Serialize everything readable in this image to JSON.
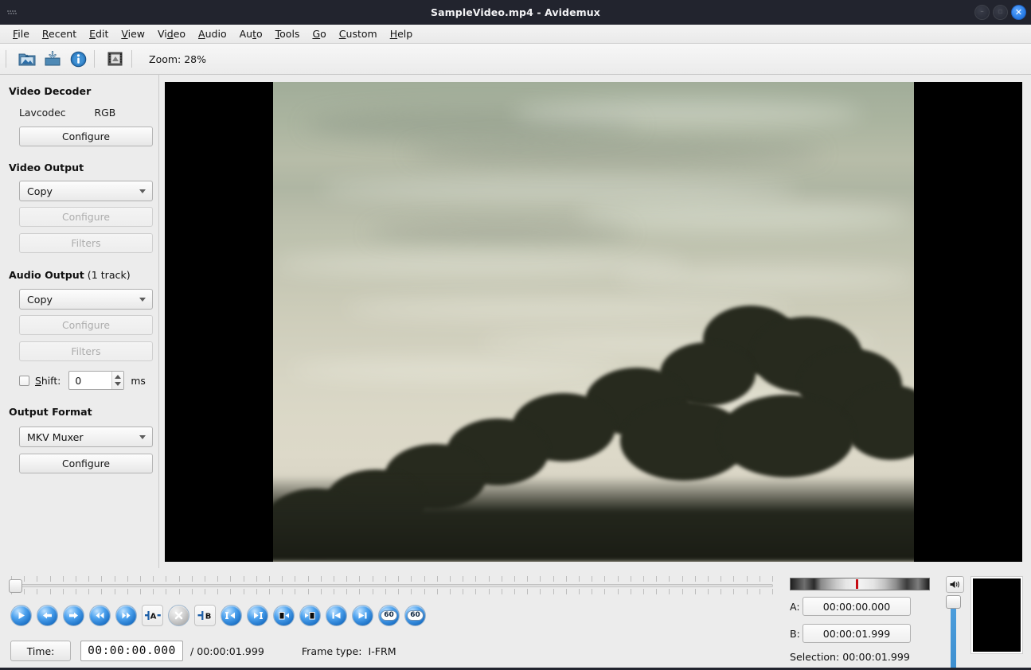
{
  "window": {
    "title": "SampleVideo.mp4 - Avidemux",
    "app_icon": "app-dots-icon",
    "controls": [
      {
        "name": "minimize-button",
        "glyph": "–"
      },
      {
        "name": "maximize-button",
        "glyph": "▫"
      },
      {
        "name": "close-button",
        "glyph": "✕"
      }
    ]
  },
  "menubar": {
    "items": [
      {
        "label": "File",
        "mnemonic": "F"
      },
      {
        "label": "Recent",
        "mnemonic": "R"
      },
      {
        "label": "Edit",
        "mnemonic": "E"
      },
      {
        "label": "View",
        "mnemonic": "V"
      },
      {
        "label": "Video",
        "mnemonic": "d"
      },
      {
        "label": "Audio",
        "mnemonic": "A"
      },
      {
        "label": "Auto",
        "mnemonic": "t"
      },
      {
        "label": "Tools",
        "mnemonic": "T"
      },
      {
        "label": "Go",
        "mnemonic": "G"
      },
      {
        "label": "Custom",
        "mnemonic": "C"
      },
      {
        "label": "Help",
        "mnemonic": "H"
      }
    ]
  },
  "toolbar": {
    "icons": [
      {
        "name": "open-file-icon",
        "title": "Open"
      },
      {
        "name": "save-file-icon",
        "title": "Save"
      },
      {
        "name": "file-info-icon",
        "title": "Properties"
      },
      {
        "name": "filmstrip-icon",
        "title": "Calculator"
      }
    ],
    "zoom_label": "Zoom: 28%"
  },
  "sidebar": {
    "video_decoder": {
      "title": "Video Decoder",
      "codec": "Lavcodec",
      "colorspace": "RGB",
      "configure_label": "Configure"
    },
    "video_output": {
      "title": "Video Output",
      "codec": "Copy",
      "configure_label": "Configure",
      "filters_label": "Filters"
    },
    "audio_output": {
      "title": "Audio Output",
      "title_suffix": " (1 track)",
      "codec": "Copy",
      "configure_label": "Configure",
      "filters_label": "Filters",
      "shift_label": "Shift:",
      "shift_value": "0",
      "shift_unit": "ms",
      "shift_checked": false
    },
    "output_format": {
      "title": "Output Format",
      "muxer": "MKV Muxer",
      "configure_label": "Configure"
    }
  },
  "transport": {
    "buttons": [
      {
        "name": "play-button",
        "icon": "play"
      },
      {
        "name": "previous-frame-button",
        "icon": "arrow-left"
      },
      {
        "name": "next-frame-button",
        "icon": "arrow-right"
      },
      {
        "name": "rewind-button",
        "icon": "double-left"
      },
      {
        "name": "forward-button",
        "icon": "double-right"
      },
      {
        "name": "set-marker-a-button",
        "icon": "marker-a"
      },
      {
        "name": "clear-markers-button",
        "icon": "cross"
      },
      {
        "name": "set-marker-b-button",
        "icon": "marker-b"
      },
      {
        "name": "previous-keyframe-button",
        "icon": "keyframe-prev"
      },
      {
        "name": "next-keyframe-button",
        "icon": "keyframe-next"
      },
      {
        "name": "previous-blackframe-button",
        "icon": "black-prev"
      },
      {
        "name": "next-blackframe-button",
        "icon": "black-next"
      },
      {
        "name": "go-to-start-button",
        "icon": "skip-start"
      },
      {
        "name": "go-to-end-button",
        "icon": "skip-end"
      },
      {
        "name": "back-60-button",
        "icon": "60"
      },
      {
        "name": "forward-60-button",
        "icon": "60"
      }
    ]
  },
  "timebar": {
    "time_button_label": "Time:",
    "current_time": "00:00:00.000",
    "total_time": "/ 00:00:01.999",
    "frame_type_label": "Frame type:",
    "frame_type_value": "I-FRM"
  },
  "markers": {
    "a_label": "A:",
    "a_value": "00:00:00.000",
    "b_label": "B:",
    "b_value": "00:00:01.999",
    "selection": "Selection: 00:00:01.999",
    "volume_icon": "speaker-icon"
  },
  "colors": {
    "titlebar": "#22242e",
    "close_button": "#2b7fe8",
    "panel": "#ececec",
    "transport_blue": "#1a6fc4",
    "vu_marker": "#c60b12",
    "volume_slider": "#4e9fdd"
  }
}
